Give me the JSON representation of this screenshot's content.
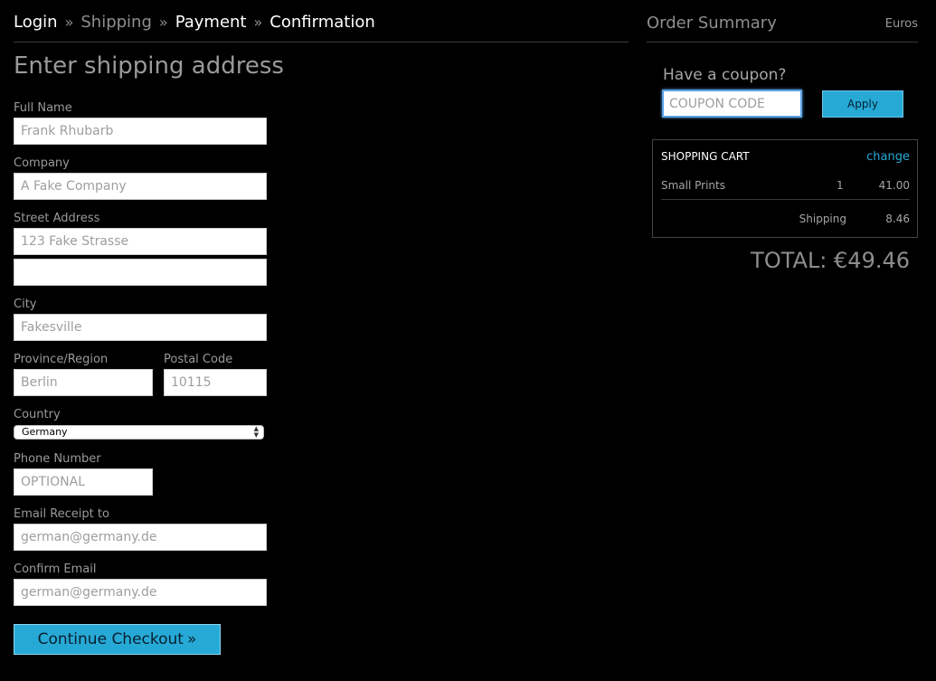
{
  "breadcrumb": {
    "steps": [
      "Login",
      "Shipping",
      "Payment",
      "Confirmation"
    ],
    "separator": "»",
    "current": "Shipping"
  },
  "heading": "Enter shipping address",
  "form": {
    "full_name": {
      "label": "Full Name",
      "placeholder": "Frank Rhubarb"
    },
    "company": {
      "label": "Company",
      "placeholder": "A Fake Company"
    },
    "street": {
      "label": "Street Address",
      "placeholder": "123 Fake Strasse",
      "placeholder2": ""
    },
    "city": {
      "label": "City",
      "placeholder": "Fakesville"
    },
    "province": {
      "label": "Province/Region",
      "placeholder": "Berlin"
    },
    "postal": {
      "label": "Postal Code",
      "placeholder": "10115"
    },
    "country": {
      "label": "Country",
      "value": "Germany"
    },
    "phone": {
      "label": "Phone Number",
      "placeholder": "OPTIONAL"
    },
    "email": {
      "label": "Email Receipt to",
      "placeholder": "german@germany.de"
    },
    "confirm_email": {
      "label": "Confirm Email",
      "placeholder": "german@germany.de"
    },
    "continue_label": "Continue Checkout",
    "continue_chevron": "»"
  },
  "summary": {
    "title": "Order Summary",
    "currency": "Euros",
    "coupon_prompt": "Have a coupon?",
    "coupon_placeholder": "COUPON CODE",
    "apply_label": "Apply",
    "cart": {
      "title": "SHOPPING CART",
      "change_label": "change",
      "items": [
        {
          "name": "Small Prints",
          "qty": "1",
          "price": "41.00"
        }
      ],
      "shipping_label": "Shipping",
      "shipping_value": "8.46"
    },
    "total": "TOTAL: €49.46"
  },
  "colors": {
    "accent": "#27a9d6",
    "background": "#000000",
    "muted_text": "#8e8e8e"
  }
}
